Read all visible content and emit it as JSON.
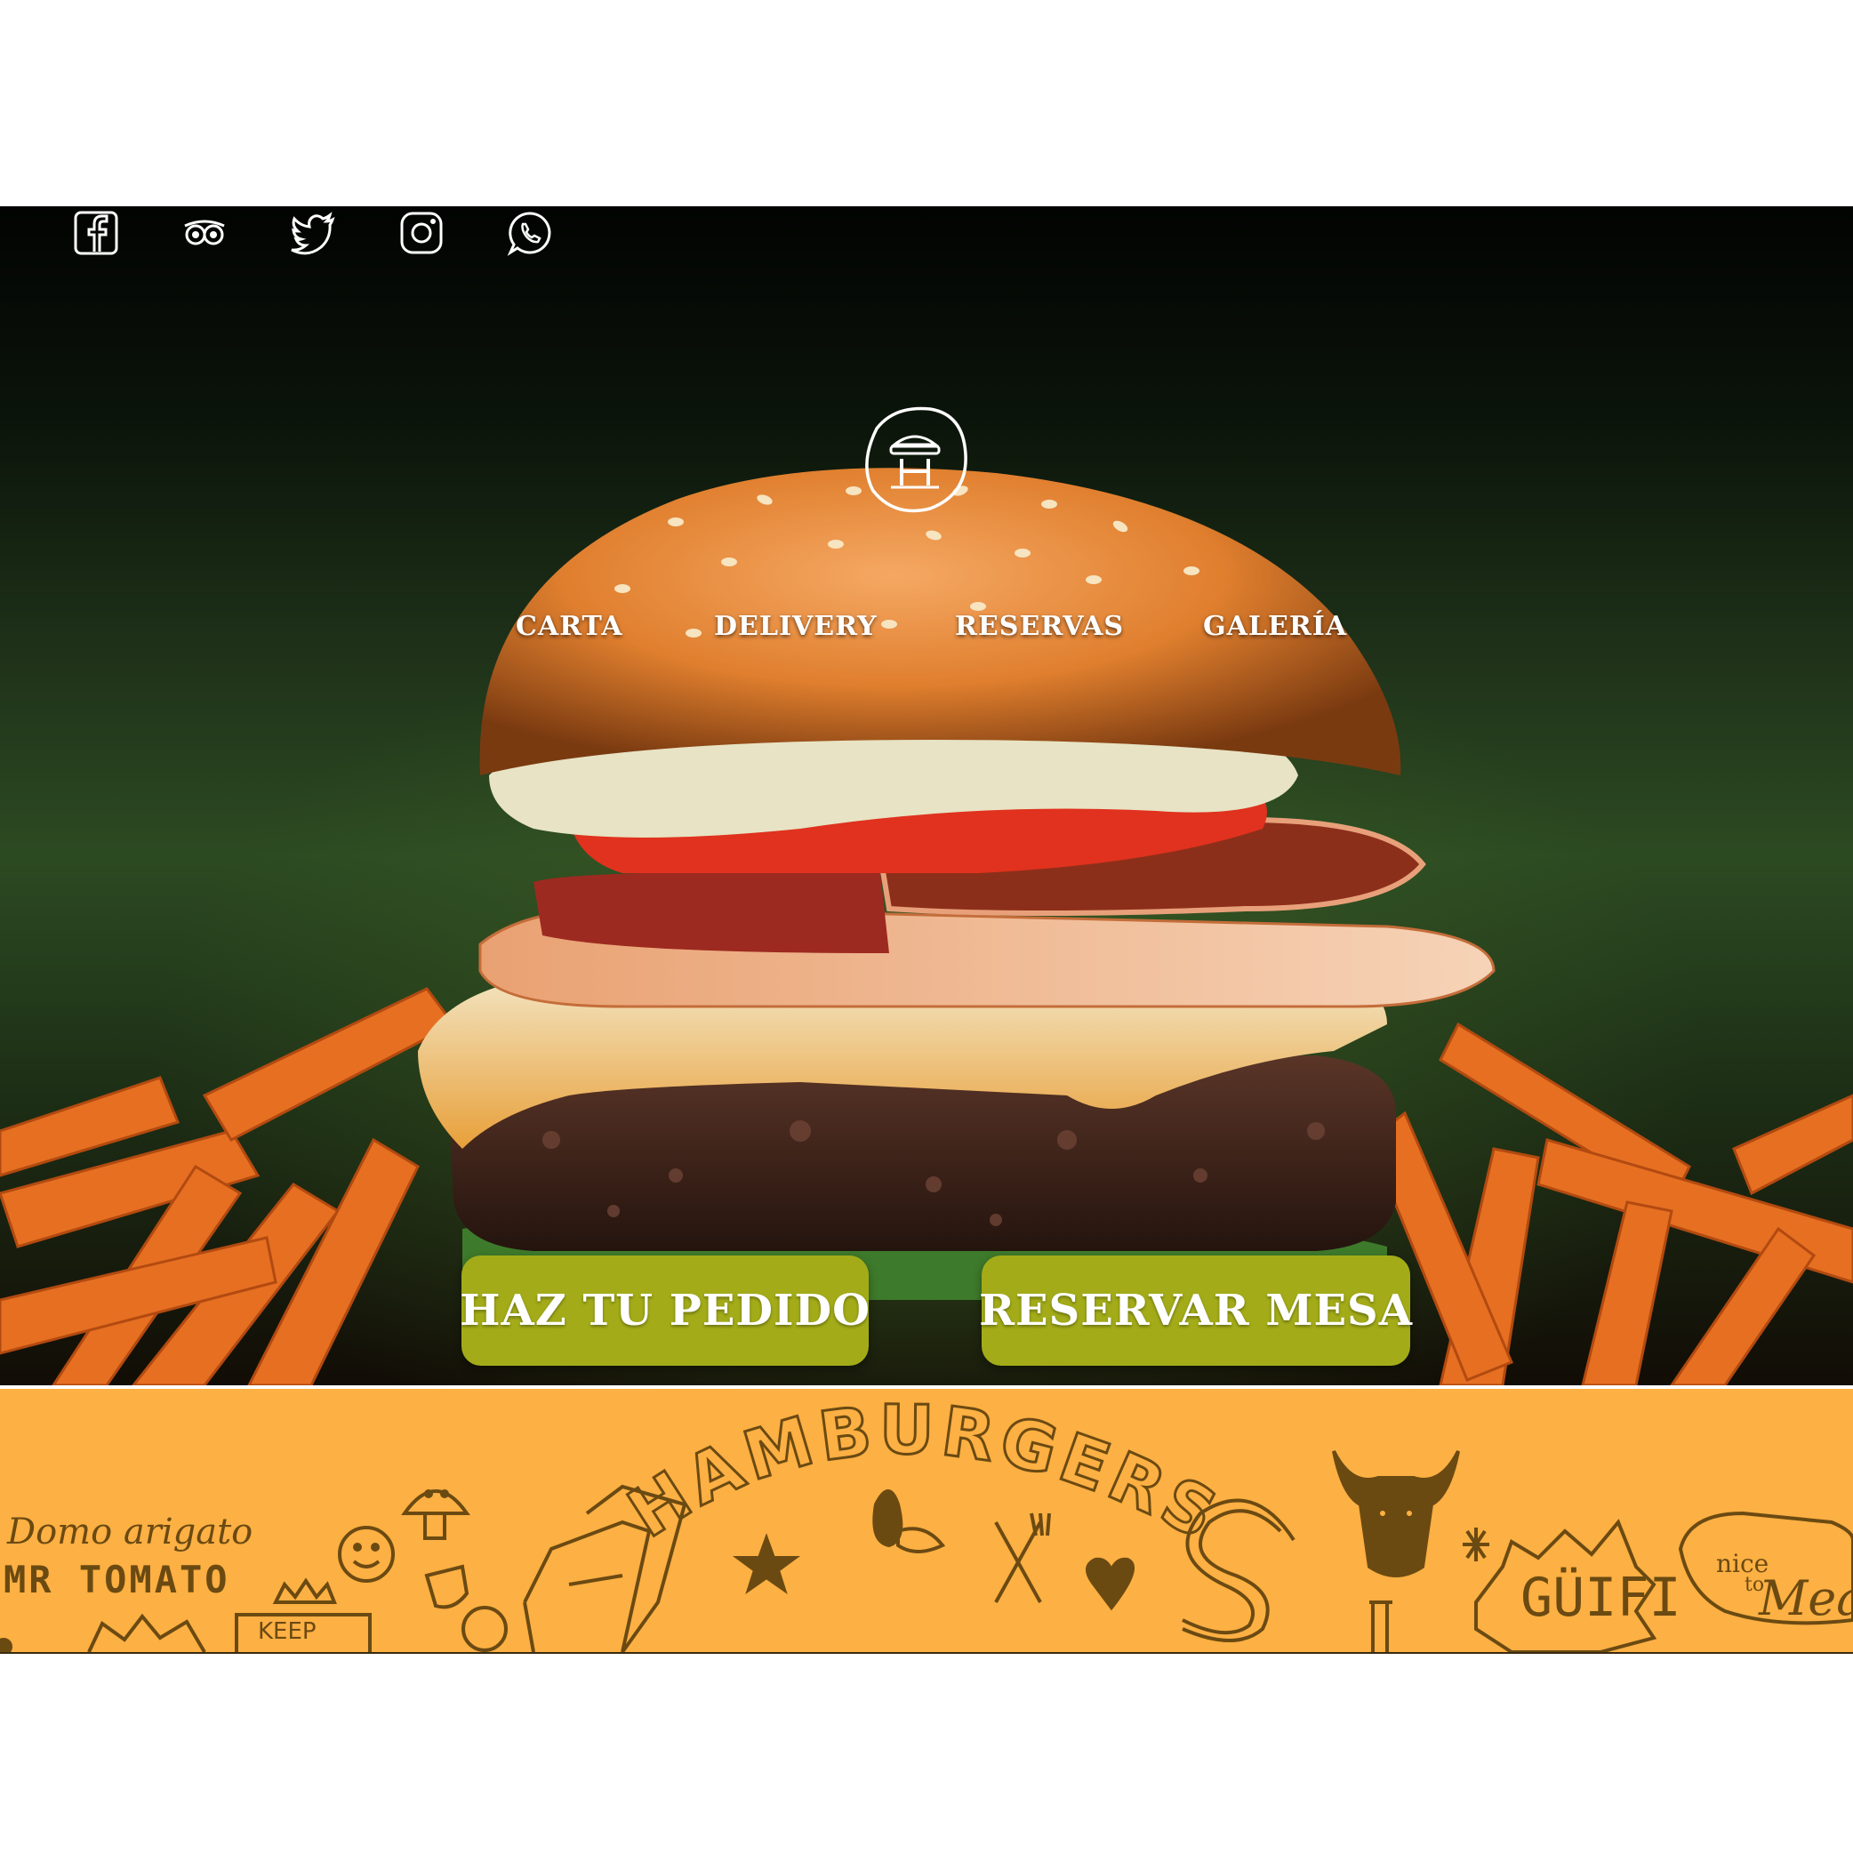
{
  "social": {
    "items": [
      {
        "name": "facebook-icon"
      },
      {
        "name": "tripadvisor-icon"
      },
      {
        "name": "twitter-icon"
      },
      {
        "name": "instagram-icon"
      },
      {
        "name": "whatsapp-icon"
      }
    ]
  },
  "nav": {
    "items": [
      {
        "label": "CARTA"
      },
      {
        "label": "DELIVERY"
      },
      {
        "label": "RESERVAS"
      },
      {
        "label": "GALERÍA"
      }
    ]
  },
  "cta": {
    "order_label": "HAZ TU PEDIDO",
    "reserve_label": "RESERVAR MESA"
  },
  "colors": {
    "cta_green": "#a3ac18",
    "banner_orange": "#fdb043",
    "doodle_brown": "#6b4a12"
  },
  "banner": {
    "domo": "Domo arigato",
    "tomato": "MR TOMATO",
    "hamburgers": "HAMBURGERS",
    "keep": "KEEP",
    "guifi": "GÜIFI",
    "nice": "nice",
    "to": "to",
    "meat": "Mea"
  }
}
